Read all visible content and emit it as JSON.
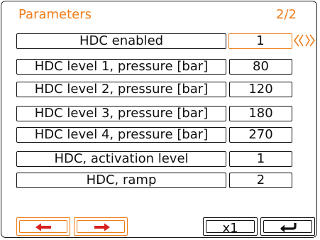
{
  "header": {
    "title": "Parameters",
    "page": "2/2"
  },
  "rows": [
    {
      "label": "HDC enabled",
      "value": "1",
      "selected": true
    },
    {
      "label": "HDC level 1, pressure [bar]",
      "value": "80"
    },
    {
      "label": "HDC level 2, pressure [bar]",
      "value": "120"
    },
    {
      "label": "HDC level 3, pressure [bar]",
      "value": "180"
    },
    {
      "label": "HDC level 4, pressure [bar]",
      "value": "270"
    },
    {
      "label": "HDC, activation level",
      "value": "1"
    },
    {
      "label": "HDC, ramp",
      "value": "2"
    }
  ],
  "footer": {
    "prev_icon": "arrow-left-icon",
    "next_icon": "arrow-right-icon",
    "multiplier_label": "x1",
    "return_icon": "return-icon"
  },
  "colors": {
    "accent": "#ef7d1a",
    "border": "#111111"
  }
}
